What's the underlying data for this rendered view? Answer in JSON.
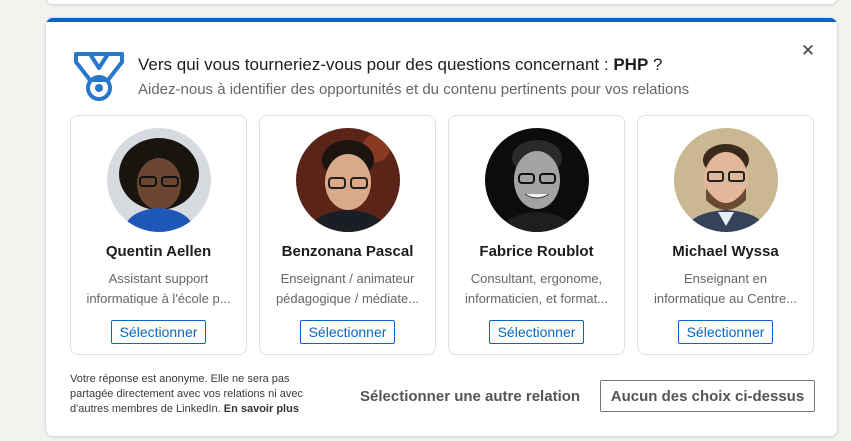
{
  "question": {
    "title_prefix": "Vers qui vous tourneriez-vous pour des questions concernant : ",
    "topic": "PHP",
    "title_suffix": " ?",
    "subtitle": "Aidez-nous à identifier des opportunités et du contenu pertinents pour vos relations"
  },
  "people": [
    {
      "name": "Quentin Aellen",
      "desc_line1": "Assistant support",
      "desc_line2": "informatique à l'école p...",
      "button": "Sélectionner"
    },
    {
      "name": "Benzonana Pascal",
      "desc_line1": "Enseignant / animateur",
      "desc_line2": "pédagogique / médiate...",
      "button": "Sélectionner"
    },
    {
      "name": "Fabrice Roublot",
      "desc_line1": "Consultant, ergonome,",
      "desc_line2": "informaticien, et format...",
      "button": "Sélectionner"
    },
    {
      "name": "Michael Wyssa",
      "desc_line1": "Enseignant en",
      "desc_line2": "informatique au Centre...",
      "button": "Sélectionner"
    }
  ],
  "footer": {
    "anon_text": "Votre réponse est anonyme. Elle ne sera pas partagée directement avec vos relations ni avec d'autres membres de LinkedIn.",
    "learn_more": "En savoir plus",
    "other_relation": "Sélectionner une autre relation",
    "none_button": "Aucun des choix ci-dessus"
  },
  "colors": {
    "accent": "#0a66c2",
    "medal": "#2977c9"
  },
  "icons": {
    "medal": "medal-icon",
    "close": "close-icon"
  }
}
